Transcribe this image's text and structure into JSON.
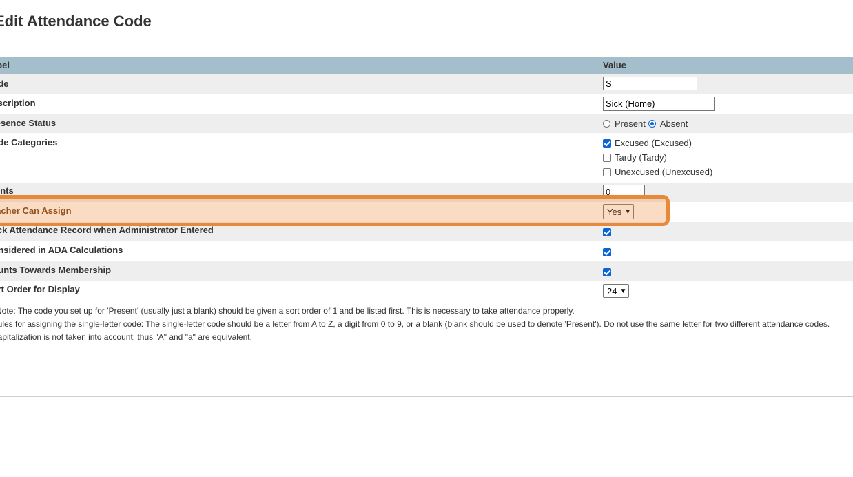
{
  "page": {
    "title": "Edit Attendance Code"
  },
  "table": {
    "header": {
      "label": "Label",
      "value": "Value"
    },
    "code": {
      "label": "Code",
      "value": "S"
    },
    "description": {
      "label": "Description",
      "value": "Sick (Home)"
    },
    "presence_status": {
      "label": "Presence Status",
      "options": [
        "Present",
        "Absent"
      ],
      "selected": "Absent"
    },
    "code_categories": {
      "label": "Code Categories",
      "items": [
        {
          "label": "Excused (Excused)",
          "checked": true
        },
        {
          "label": "Tardy (Tardy)",
          "checked": false
        },
        {
          "label": "Unexcused (Unexcused)",
          "checked": false
        }
      ]
    },
    "points": {
      "label": "Points",
      "value": "0"
    },
    "teacher_can_assign": {
      "label": "Teacher Can Assign",
      "value": "Yes"
    },
    "lock_record": {
      "label": "Lock Attendance Record when Administrator Entered",
      "checked": true
    },
    "ada_calc": {
      "label": "Considered in ADA Calculations",
      "checked": true
    },
    "membership": {
      "label": "Counts Towards Membership",
      "checked": true
    },
    "sort_order": {
      "label": "Sort Order for Display",
      "value": "24"
    }
  },
  "notes": {
    "line1": "Note: The code you set up for 'Present' (usually just a blank) should be given a sort order of 1 and be listed first. This is necessary to take attendance properly.",
    "line2": "Rules for assigning the single-letter code: The single-letter code should be a letter from A to Z, a digit from 0 to 9, or a blank (blank should be used to denote 'Present'). Do not use the same letter for two different attendance codes.",
    "line3": "Capitalization is not taken into account; thus \"A\" and \"a\" are equivalent."
  },
  "colors": {
    "header_bg": "#a4bfcb",
    "shaded_row": "#eeeeee",
    "highlight_border": "#e8883a",
    "checkbox_blue": "#0a64d6"
  }
}
